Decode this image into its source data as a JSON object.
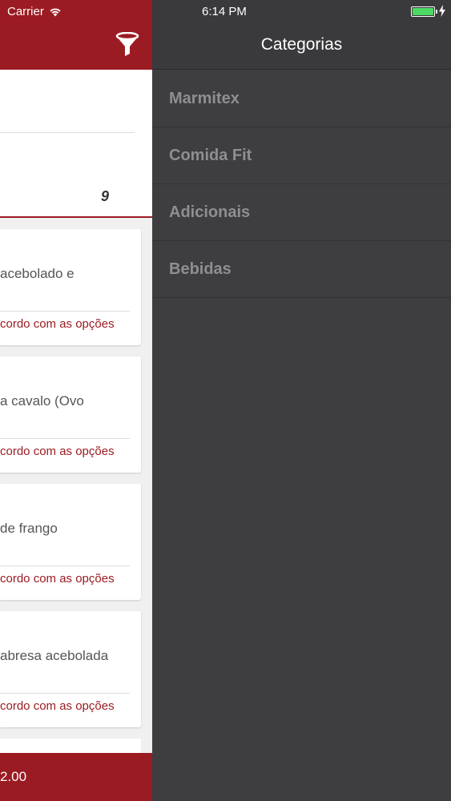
{
  "status_bar": {
    "carrier": "Carrier",
    "time": "6:14 PM",
    "battery_color": "#4cd964"
  },
  "products": {
    "count": "9",
    "items": [
      {
        "title": "acebolado e",
        "note": "cordo com as opções"
      },
      {
        "title": "a cavalo (Ovo",
        "note": "cordo com as opções"
      },
      {
        "title": "de frango",
        "note": "cordo com as opções"
      },
      {
        "title": "abresa acebolada",
        "note": "cordo com as opções"
      }
    ]
  },
  "footer": {
    "price": "2.00"
  },
  "drawer": {
    "title": "Categorias",
    "categories": [
      {
        "label": "Marmitex"
      },
      {
        "label": "Comida Fit"
      },
      {
        "label": "Adicionais"
      },
      {
        "label": "Bebidas"
      }
    ]
  },
  "colors": {
    "brand_red": "#9b1b22",
    "drawer_bg": "#3e3d3f",
    "category_text": "#8f8e90"
  }
}
